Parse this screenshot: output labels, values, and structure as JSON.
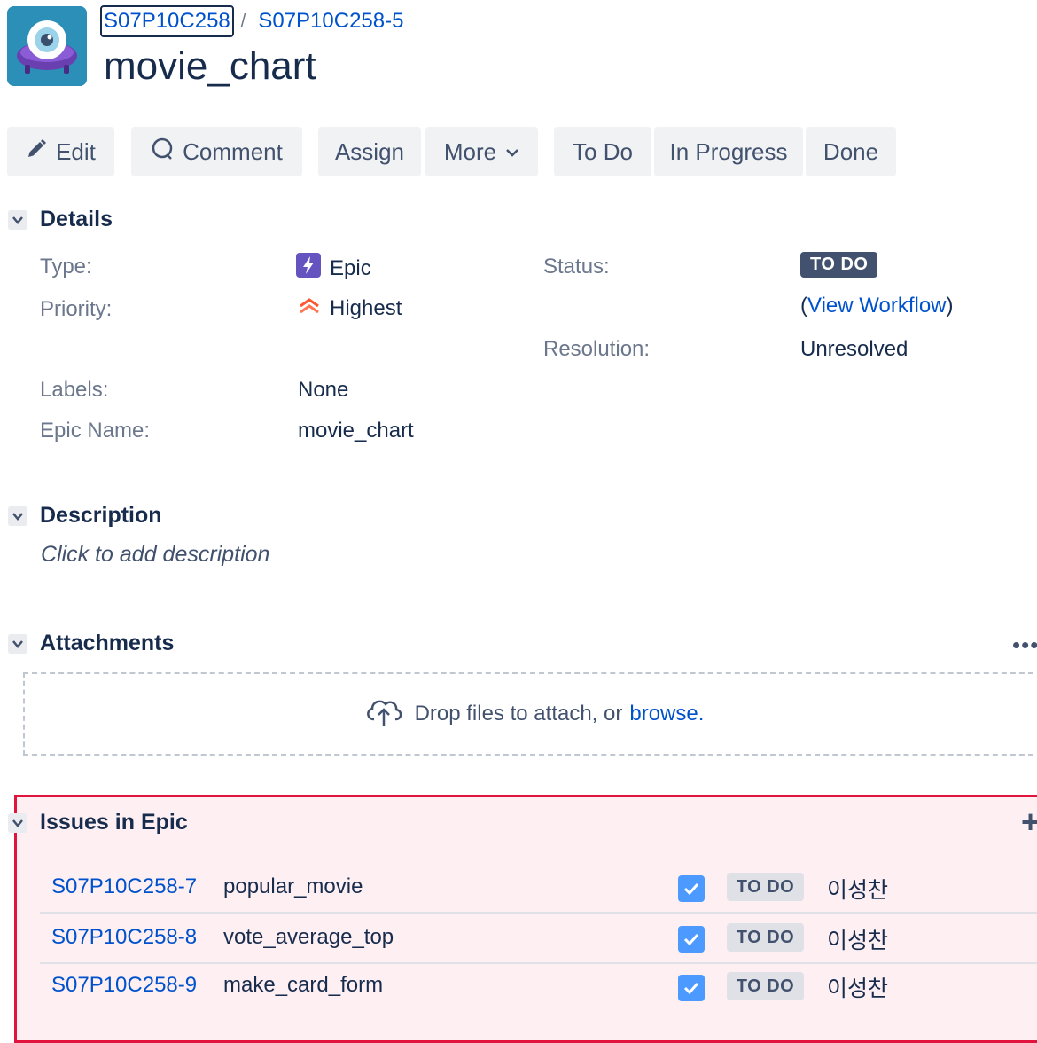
{
  "breadcrumb": {
    "project": "S07P10C258",
    "separator": "/",
    "issue": "S07P10C258-5"
  },
  "title": "movie_chart",
  "toolbar": {
    "edit": "Edit",
    "comment": "Comment",
    "assign": "Assign",
    "more": "More",
    "todo": "To Do",
    "in_progress": "In Progress",
    "done": "Done"
  },
  "details": {
    "heading": "Details",
    "type_label": "Type:",
    "type_value": "Epic",
    "priority_label": "Priority:",
    "priority_value": "Highest",
    "labels_label": "Labels:",
    "labels_value": "None",
    "epic_name_label": "Epic Name:",
    "epic_name_value": "movie_chart",
    "status_label": "Status:",
    "status_value": "TO DO",
    "workflow_open": "(",
    "workflow_link": "View Workflow",
    "workflow_close": ")",
    "resolution_label": "Resolution:",
    "resolution_value": "Unresolved"
  },
  "description": {
    "heading": "Description",
    "placeholder": "Click to add description"
  },
  "attachments": {
    "heading": "Attachments",
    "more": "•••",
    "drop_text": "Drop files to attach, or",
    "browse": "browse",
    "period": "."
  },
  "epic_issues": {
    "heading": "Issues in Epic",
    "add": "+",
    "rows": [
      {
        "key": "S07P10C258-7",
        "summary": "popular_movie",
        "status": "TO DO",
        "assignee": "이성찬"
      },
      {
        "key": "S07P10C258-8",
        "summary": "vote_average_top",
        "status": "TO DO",
        "assignee": "이성찬"
      },
      {
        "key": "S07P10C258-9",
        "summary": "make_card_form",
        "status": "TO DO",
        "assignee": "이성찬"
      }
    ]
  },
  "colors": {
    "link": "#0052cc",
    "todo_dark": "#42526e",
    "epic_purple": "#6554c0",
    "priority_highest": "#ff5630",
    "highlight_border": "#e0143c"
  },
  "icons": [
    "project-avatar-icon",
    "pencil-icon",
    "comment-icon",
    "chevron-down-icon",
    "epic-icon",
    "priority-highest-icon",
    "cloud-upload-icon",
    "checkbox-checked-icon"
  ]
}
